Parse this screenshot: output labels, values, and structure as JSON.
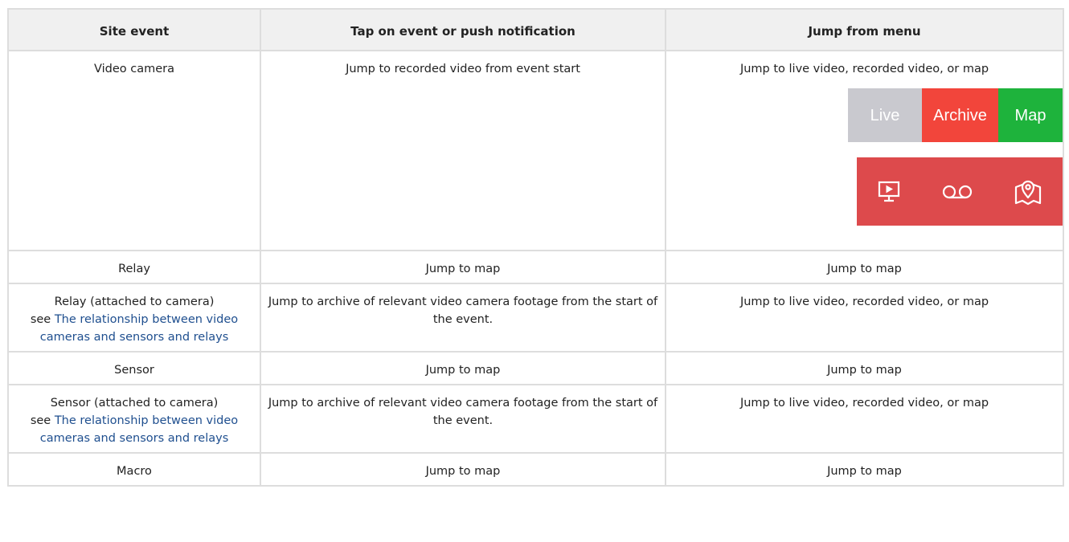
{
  "table": {
    "headers": [
      "Site event",
      "Tap on event or push notification",
      "Jump from menu"
    ],
    "link_text": "The relationship between video cameras and sensors and relays",
    "see_prefix": "see",
    "rows": [
      {
        "event": "Video camera",
        "tap": "Jump to recorded video from event start",
        "menu": "Jump to live video, recorded video, or map"
      },
      {
        "event": "Relay",
        "tap": "Jump to map",
        "menu": "Jump to map"
      },
      {
        "event": "Relay (attached to camera)",
        "tap": "Jump to archive of relevant video camera footage from the start of the event.",
        "menu": "Jump to live video, recorded video, or map"
      },
      {
        "event": "Sensor",
        "tap": "Jump to map",
        "menu": "Jump to map"
      },
      {
        "event": "Sensor (attached to camera)",
        "tap": "Jump to archive of relevant video camera footage from the start of the event.",
        "menu": "Jump to live video, recorded video, or map"
      },
      {
        "event": "Macro",
        "tap": "Jump to map",
        "menu": "Jump to map"
      }
    ]
  },
  "segmented_control": {
    "labels": [
      "Live",
      "Archive",
      "Map"
    ],
    "colors": {
      "live": "#c9c9cf",
      "archive": "#f2453b",
      "map": "#1eb33c"
    }
  },
  "icon_bar": {
    "background": "#dd4a4c",
    "icons": [
      "live-video-monitor-icon",
      "archive-voicemail-icon",
      "map-pin-icon"
    ]
  }
}
